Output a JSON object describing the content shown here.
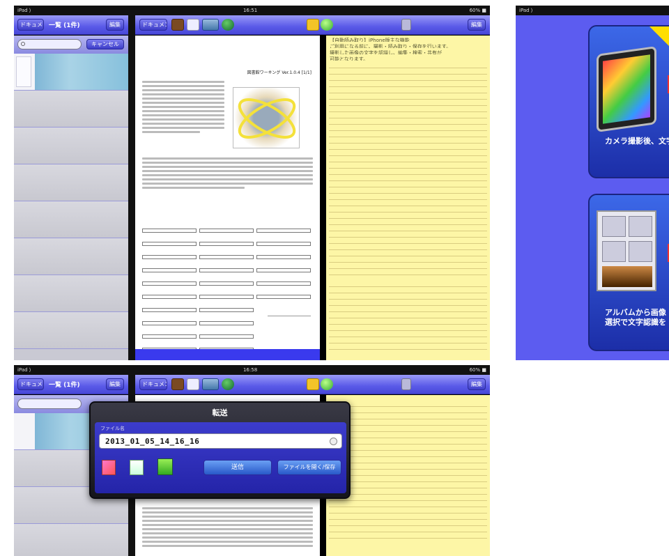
{
  "top_screen": {
    "status": {
      "left": "iPad ⟩",
      "time": "16:51",
      "right": "60% ■"
    },
    "list_panel": {
      "title": "一覧 (1件)",
      "left_button": "ドキュメント",
      "right_button": "編集",
      "search_placeholder": "",
      "search_button": "キャンセル",
      "rows": 8
    },
    "toolbar": {
      "left_button": "ドキュメント",
      "right_button": "編集"
    },
    "document": {
      "heading": "図書館ワーキング Ver.1.0.4 [1/1]"
    },
    "memo": {
      "lines": [
        "【自動読み取り】iPhone版主な機能",
        "ご利用になる前に、撮影・読み取り・保存を行います。",
        "撮影した画像の文字を認識し、編集・検索・共有が",
        "可能となります。",
        "",
        "",
        "",
        "",
        "",
        "",
        "",
        "",
        "",
        "",
        "",
        "",
        "",
        "",
        "",
        "",
        "",
        "",
        "",
        "",
        "",
        "",
        "",
        "",
        "",
        "",
        "",
        "",
        "",
        "",
        "",
        "",
        "",
        "",
        "",
        "",
        "",
        "",
        "",
        "",
        "",
        "",
        "",
        "",
        "",
        "",
        ""
      ]
    }
  },
  "right_screen": {
    "status": {
      "left": "iPad ⟩"
    },
    "card1": {
      "text": "カメラ撮影後、文字認識を行う"
    },
    "card2": {
      "text": "アルバムから画像選択で文字認識を行う"
    }
  },
  "bottom_screen": {
    "status": {
      "left": "iPad ⟩",
      "time": "16:58",
      "right": "60% ■"
    },
    "list_panel": {
      "title": "一覧 (1件)",
      "left_button": "ドキュメント",
      "right_button": "編集"
    },
    "toolbar": {
      "left_button": "ドキュメント",
      "right_button": "編集"
    },
    "dialog": {
      "title": "転送",
      "field_label": "ファイル名",
      "field_value": "2013_01_05_14_16_16",
      "left_button": "送信",
      "right_button": "ファイルを開く/保存"
    }
  },
  "colors": {
    "toolbar": "#5a5ae8",
    "memo": "#fdf6a6",
    "card": "#2a44c0",
    "accent": "#ffde00"
  }
}
